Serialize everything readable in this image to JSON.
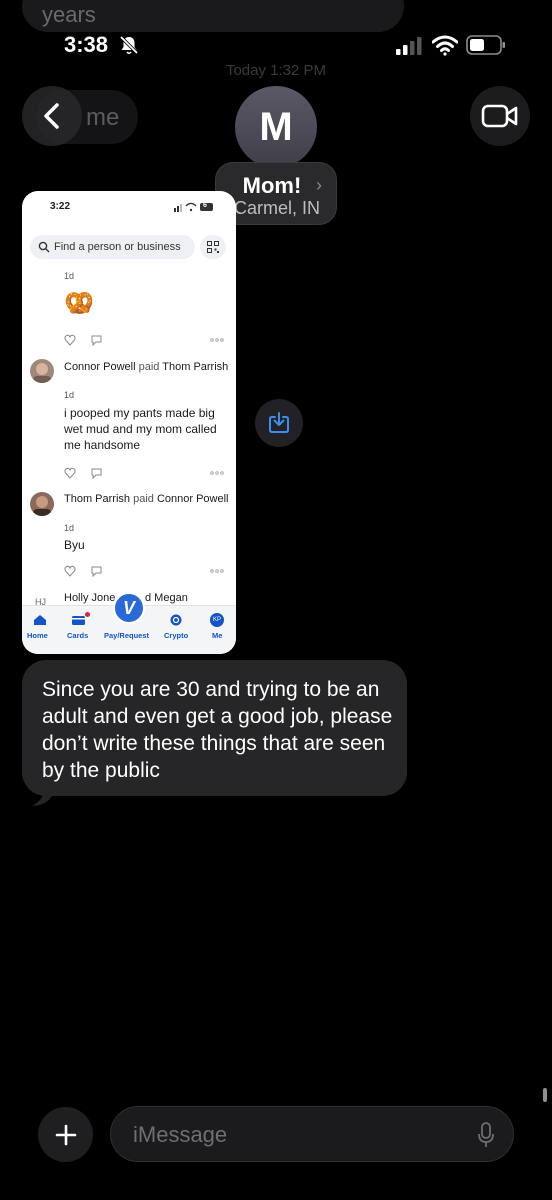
{
  "background": {
    "previous_message_fragment": "years",
    "previous_bubble_fragment": "me",
    "timestamp": "Today 1:32 PM"
  },
  "status_bar": {
    "time": "3:38",
    "icons": [
      "bell-slash-icon",
      "cellular-signal-icon",
      "wifi-icon",
      "battery-icon"
    ]
  },
  "header": {
    "avatar_initial": "M",
    "contact_name": "Mom!",
    "chevron": "›",
    "contact_location": "Carmel, IN",
    "back_icon": "chevron-left-icon",
    "video_icon": "video-camera-icon"
  },
  "attachment": {
    "status_time": "3:22",
    "status_battery": "6",
    "search_placeholder": "Find a person or business",
    "feed": [
      {
        "meta": "1d",
        "emoji": "🥨"
      },
      {
        "payer": "Connor Powell",
        "verb": "paid",
        "payee": "Thom Parrish",
        "meta": "1d",
        "note": "i pooped my pants made big wet mud and my mom called me handsome"
      },
      {
        "payer": "Thom Parrish",
        "verb": "paid",
        "payee": "Connor Powell",
        "meta": "1d",
        "note": "Byu"
      },
      {
        "initials": "HJ",
        "payer": "Holly Jone",
        "payee_fragment": "d Megan"
      }
    ],
    "nav": {
      "home": "Home",
      "cards": "Cards",
      "pay_request": "Pay/Request",
      "crypto": "Crypto",
      "me": "Me",
      "me_initials": "KP",
      "fab_letter": "V"
    }
  },
  "message": {
    "text": "Since you are 30 and trying to be an adult and even get a good job, please don’t write these things that are seen by the public"
  },
  "composer": {
    "placeholder": "iMessage",
    "plus_label": "+"
  },
  "colors": {
    "background": "#000000",
    "bubble": "#262628",
    "venmo_blue": "#1454c8",
    "share_blue": "#3b8ef0"
  }
}
